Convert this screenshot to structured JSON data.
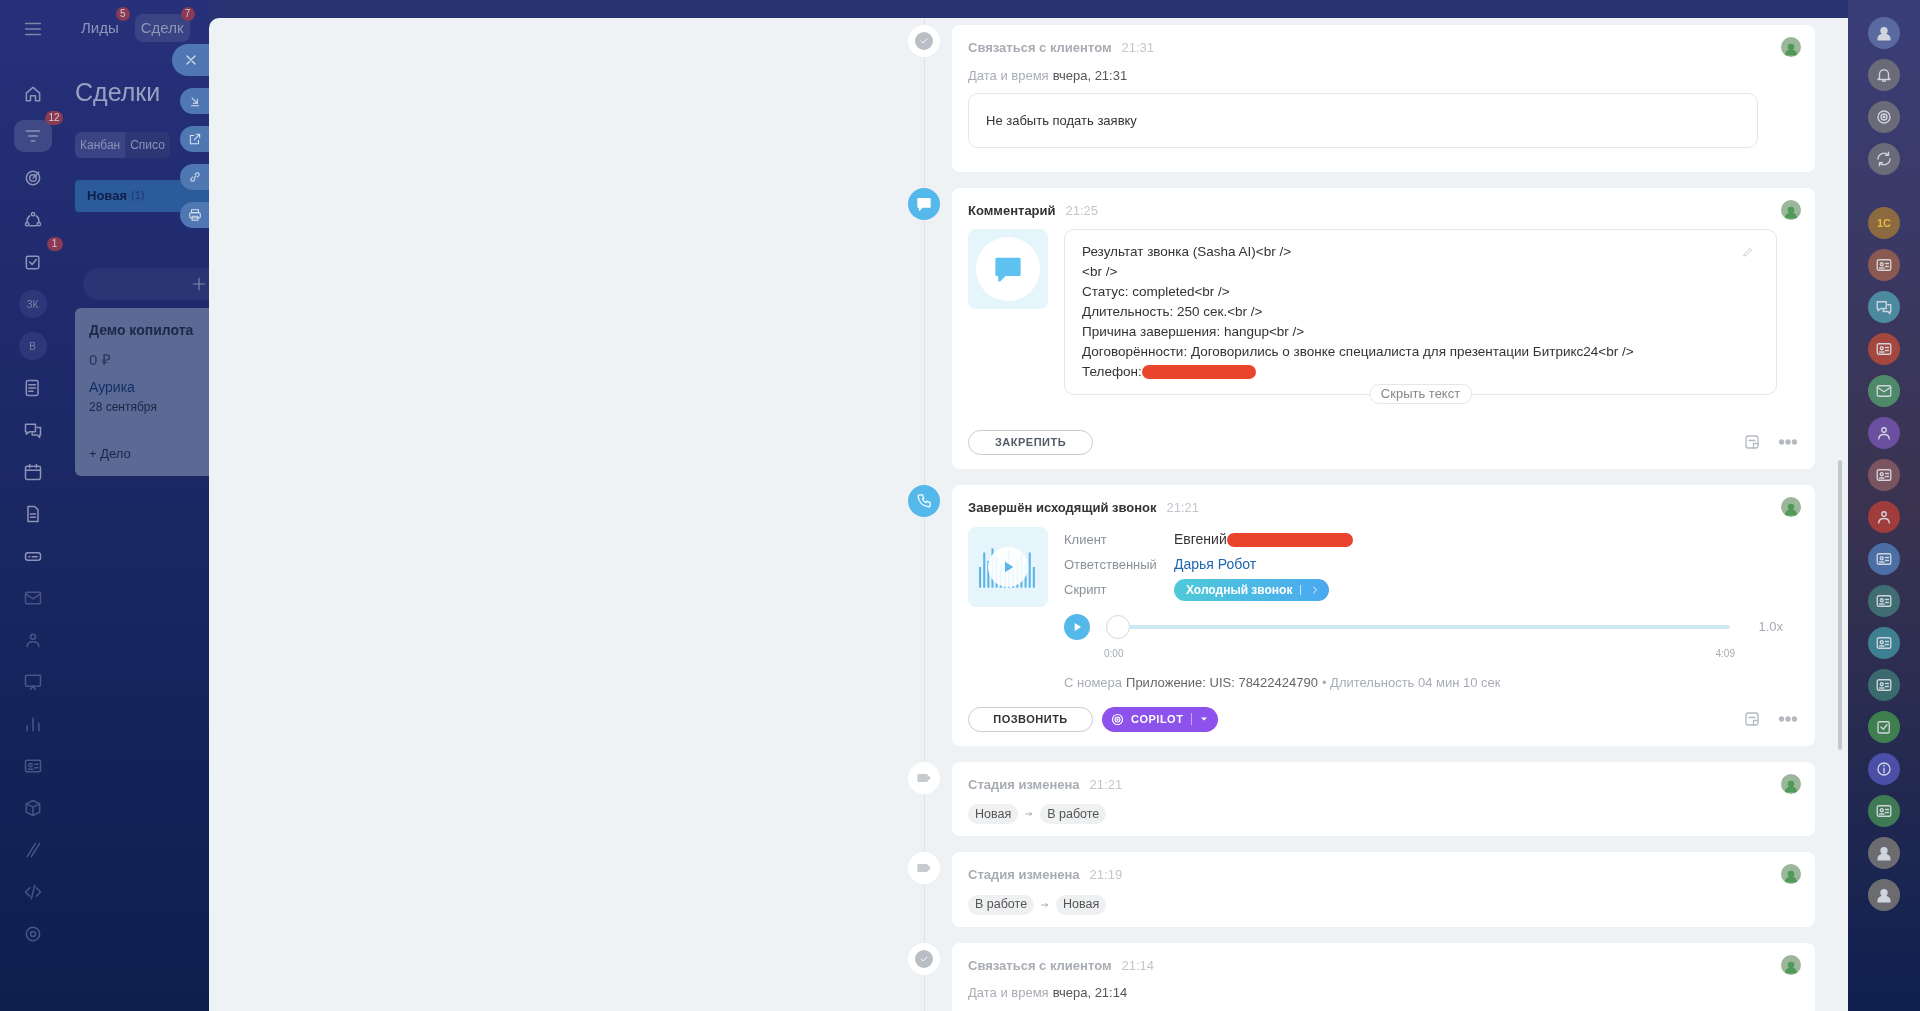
{
  "left_sidebar": {
    "items": [
      {
        "kind": "home",
        "selected": false
      },
      {
        "kind": "funnel",
        "selected": true,
        "badge": "12"
      },
      {
        "kind": "target",
        "selected": false
      },
      {
        "kind": "cycle",
        "selected": false
      },
      {
        "kind": "tasks",
        "selected": false,
        "badge": "1"
      },
      {
        "kind": "avatar",
        "selected": false,
        "label": "ЗК"
      },
      {
        "kind": "avatar",
        "selected": false,
        "label": "В"
      },
      {
        "kind": "news",
        "selected": false
      },
      {
        "kind": "chat",
        "selected": false
      },
      {
        "kind": "calendar",
        "selected": false
      },
      {
        "kind": "doc",
        "selected": false
      },
      {
        "kind": "drive",
        "selected": false
      },
      {
        "kind": "mail",
        "selected": false
      },
      {
        "kind": "people",
        "selected": false
      },
      {
        "kind": "board",
        "selected": false
      },
      {
        "kind": "chart",
        "selected": false
      },
      {
        "kind": "card",
        "selected": false
      },
      {
        "kind": "box",
        "selected": false
      },
      {
        "kind": "brush",
        "selected": false
      },
      {
        "kind": "code",
        "selected": false
      },
      {
        "kind": "gear",
        "selected": false
      }
    ]
  },
  "header_tabs": [
    {
      "label": "Лиды",
      "badge": "5",
      "selected": false
    },
    {
      "label": "Сделк",
      "badge": "7",
      "selected": true
    }
  ],
  "page_title": "Сделки",
  "view_tabs": [
    {
      "label": "Канбан",
      "selected": false
    },
    {
      "label": "Списо",
      "selected": true
    }
  ],
  "kanban": {
    "column": {
      "name": "Новая",
      "count": "(1)"
    },
    "card": {
      "title": "Демо копилота",
      "amount": "0 ₽",
      "company": "Аурика",
      "date": "28 сентября",
      "add": "+ Дело"
    }
  },
  "slider_actions": [
    {
      "kind": "close"
    },
    {
      "kind": "collapse"
    },
    {
      "kind": "open"
    },
    {
      "kind": "link"
    },
    {
      "kind": "print"
    }
  ],
  "timeline": [
    {
      "kind": "task",
      "done": true,
      "title": "Связаться с клиентом",
      "time": "21:31",
      "date_label": "Дата и время",
      "date_value": "вчера, 21:31",
      "note": "Не забыть подать заявку"
    },
    {
      "kind": "comment",
      "title": "Комментарий",
      "time": "21:25",
      "lines": [
        "Результат звонка (Sasha AI)<br />",
        "<br />",
        "Статус: completed<br />",
        "Длительность: 250 сек.<br />",
        "Причина завершения: hangup<br />",
        "Договорённости: Договорились о звонке специалиста для презентации Битрикс24<br />"
      ],
      "phone_label": "Телефон:",
      "phone_redacted": true,
      "hide_button": "Скрыть текст",
      "pin_button": "ЗАКРЕПИТЬ"
    },
    {
      "kind": "call",
      "title": "Завершён исходящий звонок",
      "time": "21:21",
      "fields": [
        {
          "kind": "text",
          "label": "Клиент",
          "value": "Евгений",
          "redacted": true
        },
        {
          "kind": "link",
          "label": "Ответственный",
          "value": "Дарья Робот",
          "redacted": false
        },
        {
          "kind": "tag",
          "label": "Скрипт",
          "value": "Холодный звонок",
          "redacted": false
        }
      ],
      "player": {
        "level": 0,
        "start": "0:00",
        "end": "4:09",
        "speed": "1.0x"
      },
      "from_label": "С номера",
      "from_value": "Приложение: UIS: 78422424790",
      "duration": "• Длительность 04 мин 10 сек",
      "call_button": "ПОЗВОНИТЬ",
      "copilot_button": "COPILOT"
    },
    {
      "kind": "stage",
      "title": "Стадия изменена",
      "time": "21:21",
      "from": "Новая",
      "to": "В работе"
    },
    {
      "kind": "stage",
      "title": "Стадия изменена",
      "time": "21:19",
      "from": "В работе",
      "to": "Новая"
    },
    {
      "kind": "task",
      "done": true,
      "title": "Связаться с клиентом",
      "time": "21:14",
      "date_label": "Дата и время",
      "date_value": "вчера, 21:14"
    }
  ],
  "right_sidebar": {
    "items": [
      {
        "kind": "user",
        "color": "#5a6aa0"
      },
      {
        "kind": "bell",
        "color": "#6a6a78"
      },
      {
        "kind": "copilot",
        "color": "#6a6a78"
      },
      {
        "kind": "sync",
        "color": "#6a6a78"
      },
      {
        "kind": "logo",
        "color": "#8a6a3e",
        "label": "1С"
      },
      {
        "kind": "card",
        "color": "#8a5a52"
      },
      {
        "kind": "chat",
        "color": "#4b8aa0"
      },
      {
        "kind": "card",
        "color": "#a4473f"
      },
      {
        "kind": "mail",
        "color": "#4e8a6a"
      },
      {
        "kind": "people",
        "color": "#6b4fa0"
      },
      {
        "kind": "card",
        "color": "#7a5560"
      },
      {
        "kind": "people",
        "color": "#a03c3c"
      },
      {
        "kind": "card",
        "color": "#4b6fa5"
      },
      {
        "kind": "card",
        "color": "#3f6d72"
      },
      {
        "kind": "card",
        "color": "#3f7f92"
      },
      {
        "kind": "card",
        "color": "#3a6a6e"
      },
      {
        "kind": "tasks",
        "color": "#3f7f4f"
      },
      {
        "kind": "info",
        "color": "#4b4fa8"
      },
      {
        "kind": "card",
        "color": "#3f7a55"
      },
      {
        "kind": "user",
        "color": "#6b6b70"
      },
      {
        "kind": "user",
        "color": "#6b6b70"
      }
    ]
  }
}
